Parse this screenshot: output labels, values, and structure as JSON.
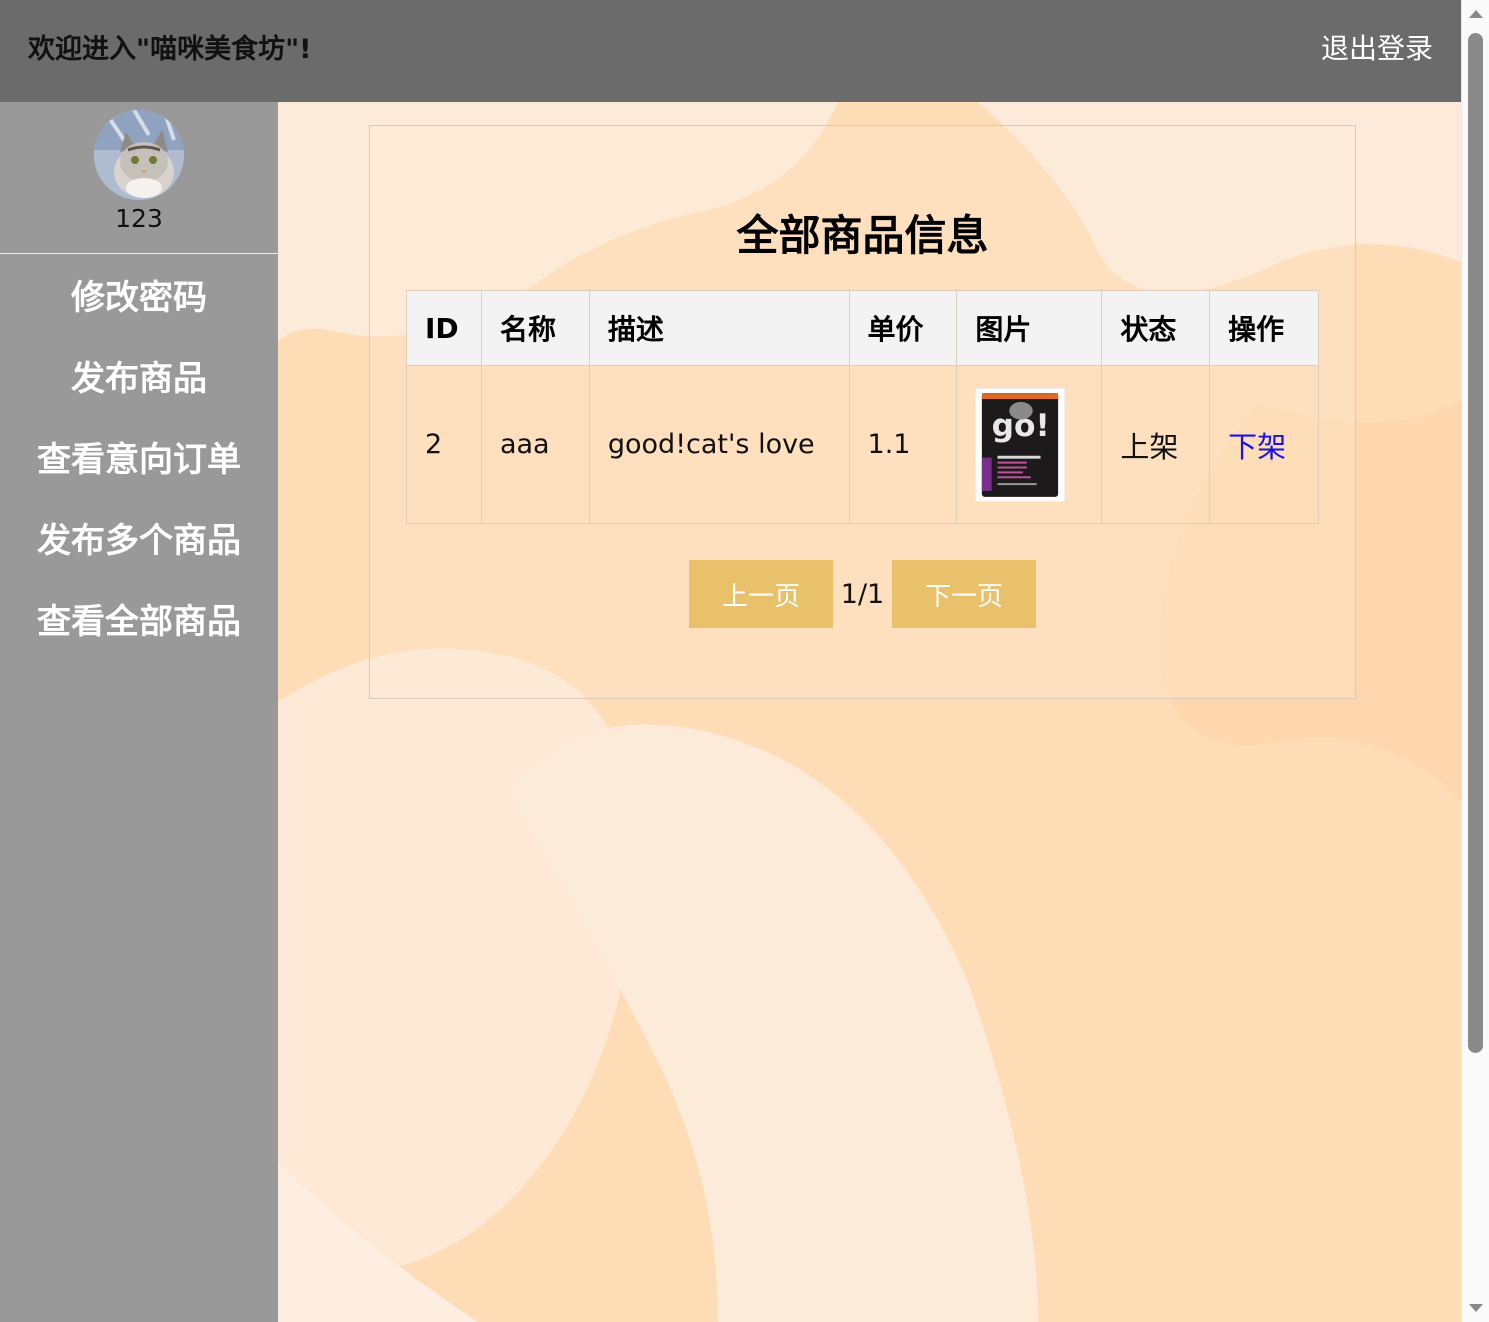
{
  "header": {
    "welcome": "欢迎进入\"喵咪美食坊\"!",
    "logout": "退出登录"
  },
  "sidebar": {
    "avatar_icon": "cat-avatar",
    "username": "123",
    "items": [
      {
        "label": "修改密码"
      },
      {
        "label": "发布商品"
      },
      {
        "label": "查看意向订单"
      },
      {
        "label": "发布多个商品"
      },
      {
        "label": "查看全部商品"
      }
    ]
  },
  "main": {
    "title": "全部商品信息",
    "table": {
      "headers": [
        "ID",
        "名称",
        "描述",
        "单价",
        "图片",
        "状态",
        "操作"
      ],
      "rows": [
        {
          "id": "2",
          "name": "aaa",
          "description": "good!cat's love",
          "price": "1.1",
          "image_icon": "cat-food-bag-image",
          "status": "上架",
          "action": "下架"
        }
      ]
    },
    "pager": {
      "prev": "上一页",
      "page": "1/1",
      "next": "下一页"
    }
  },
  "colors": {
    "header_bg": "#6b6b6b",
    "sidebar_bg": "#999999",
    "page_bg": "#fde0bf",
    "button_bg": "#e8c16a",
    "link": "#1a12e8"
  }
}
